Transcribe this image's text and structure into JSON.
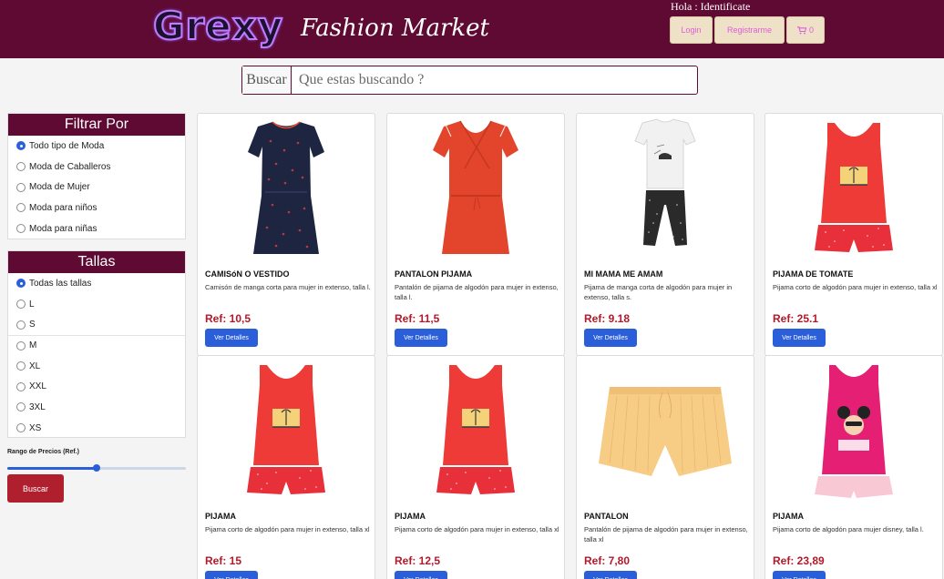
{
  "header": {
    "logo": "Grexy",
    "tagline": "Fashion Market",
    "greeting": "Hola : Identificate",
    "login_label": "Login",
    "register_label": "Registrarme",
    "cart_count": "0"
  },
  "search": {
    "label": "Buscar",
    "placeholder": "Que estas buscando ?"
  },
  "filters": {
    "title": "Filtrar Por",
    "options": [
      "Todo tipo de Moda",
      "Moda de Caballeros",
      "Moda de Mujer",
      "Moda para niños",
      "Moda para niñas"
    ],
    "selected": 0
  },
  "sizes": {
    "title": "Tallas",
    "options": [
      "Todas las tallas",
      "L",
      "S",
      "M",
      "XL",
      "XXL",
      "3XL",
      "XS"
    ],
    "selected": 0
  },
  "price": {
    "label": "Rango de Precios (Ref.)",
    "slider_fraction": 0.5
  },
  "sidebar_search_label": "Buscar",
  "products": [
    {
      "name": "CAMISóN O VESTIDO",
      "description": "Camisón de manga corta para mujer in extenso, talla l.",
      "price": "Ref: 10,5",
      "button": "Ver Detalles"
    },
    {
      "name": "PANTALON PIJAMA",
      "description": "Pantalón de pijama de algodón para mujer in extenso, talla l.",
      "price": "Ref: 11,5",
      "button": "Ver Detalles"
    },
    {
      "name": "MI MAMA ME AMAM",
      "description": "Pijama de manga corta de algodón para mujer in extenso, talla s.",
      "price": "Ref: 9.18",
      "button": "Ver Detalles"
    },
    {
      "name": "PIJAMA DE TOMATE",
      "description": "Pijama corto de algodón para mujer in extenso, talla xl",
      "price": "Ref: 25.1",
      "button": "Ver Detalles"
    },
    {
      "name": "PIJAMA",
      "description": "Pijama corto de algodón para mujer in extenso, talla xl",
      "price": "Ref: 15",
      "button": "Ver Detalles"
    },
    {
      "name": "PIJAMA",
      "description": "Pijama corto de algodón para mujer in extenso, talla xl",
      "price": "Ref: 12,5",
      "button": "Ver Detalles"
    },
    {
      "name": "PANTALON",
      "description": "Pantalón de pijama de algodón para mujer in extenso, talla xl",
      "price": "Ref: 7,80",
      "button": "Ver Detalles"
    },
    {
      "name": "PIJAMA",
      "description": "Pijama corto de algodón para mujer disney, talla l.",
      "price": "Ref: 23,89",
      "button": "Ver Detalles"
    }
  ],
  "colors": {
    "brand": "#5e0a33",
    "primary_button": "#2b5fd9",
    "search_button": "#b01f2e",
    "price_text": "#b11a2a"
  }
}
